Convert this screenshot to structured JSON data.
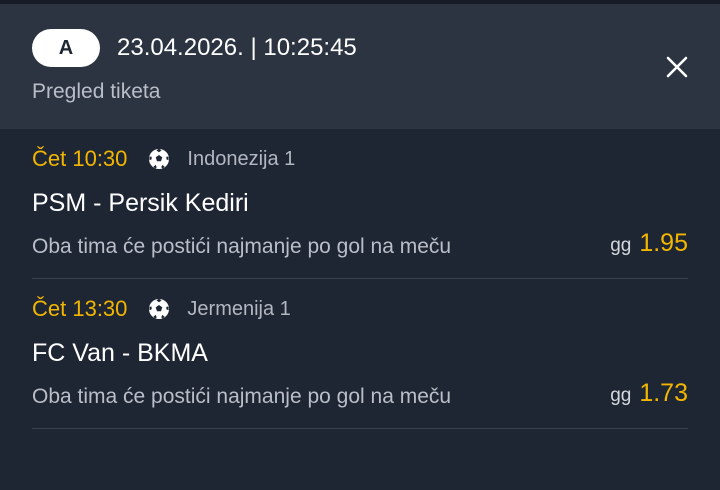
{
  "header": {
    "badge_label": "A",
    "datetime": "23.04.2026. | 10:25:45",
    "subtitle": "Pregled tiketa",
    "close_icon": "close-icon"
  },
  "matches": [
    {
      "time": "Čet 10:30",
      "sport_icon": "soccer-ball-icon",
      "league": "Indonezija 1",
      "teams": "PSM - Persik Kediri",
      "market": "Oba tima će postići najmanje po gol na meču",
      "pick_code": "gg",
      "odds": "1.95"
    },
    {
      "time": "Čet 13:30",
      "sport_icon": "soccer-ball-icon",
      "league": "Jermenija 1",
      "teams": "FC Van - BKMA",
      "market": "Oba tima će postići najmanje po gol na meču",
      "pick_code": "gg",
      "odds": "1.73"
    }
  ],
  "colors": {
    "background": "#1f2633",
    "header_background": "#2c3442",
    "accent_time_odds": "#f2b600",
    "secondary_text": "#b9bec8"
  }
}
